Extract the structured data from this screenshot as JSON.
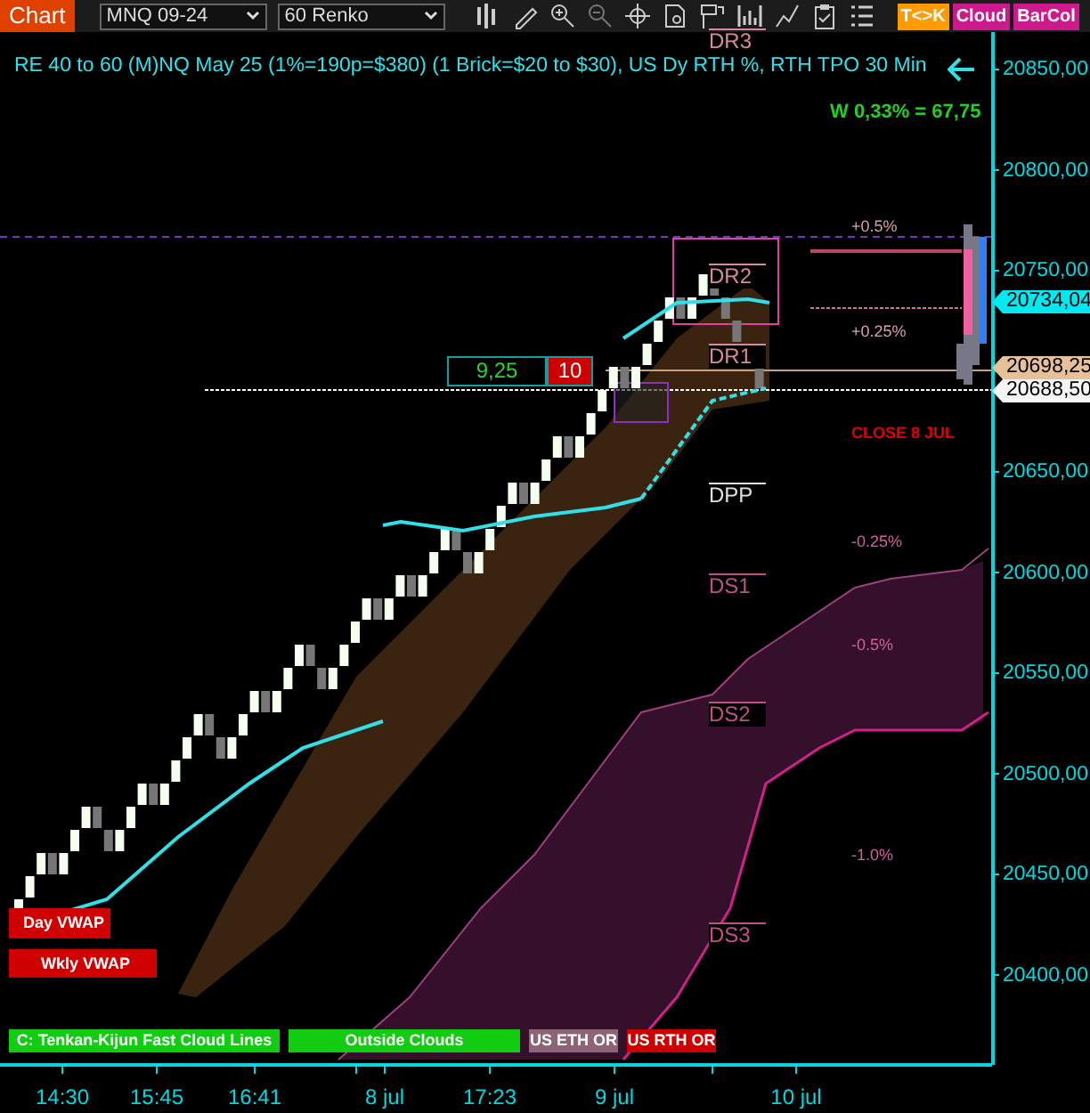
{
  "toolbar": {
    "title": "Chart",
    "instrument": "MNQ 09-24",
    "bar_type": "60 Renko",
    "buttons": [
      {
        "label": "T<>K",
        "color": "#ff9900"
      },
      {
        "label": "Cloud",
        "color": "#cc1a8c"
      },
      {
        "label": "BarCol",
        "color": "#cc1a8c"
      }
    ]
  },
  "chart": {
    "caption": "RE 40 to 60 (M)NQ May 25 (1%=190p=$380) (1 Brick=$20 to $30), US Dy RTH %, RTH TPO 30 Min",
    "range_text": "W 0,33% = 67,75",
    "levels": [
      {
        "label": "DR3",
        "color": "#d88a9c"
      },
      {
        "label": "DR2",
        "color": "#d88a9c"
      },
      {
        "label": "DR1",
        "color": "#d88a9c"
      },
      {
        "label": "DPP",
        "color": "#e0e0e0"
      },
      {
        "label": "DS1",
        "color": "#c0508a"
      },
      {
        "label": "DS2",
        "color": "#c0508a"
      },
      {
        "label": "DS3",
        "color": "#c0508a"
      }
    ],
    "percent_labels": [
      "+0.5%",
      "+0.25%",
      "-0.25%",
      "-0.5%",
      "-1.0%"
    ],
    "close_label": "CLOSE 8 JUL",
    "brick_counter": {
      "value": "9,25",
      "count": "10"
    },
    "vwap_labels": [
      "Day VWAP",
      "Wkly VWAP"
    ],
    "indicators": [
      {
        "label": "C: Tenkan-Kijun Fast Cloud Lines",
        "color": "#11cc11"
      },
      {
        "label": "Outside Clouds",
        "color": "#11cc11"
      },
      {
        "label": "US ETH OR",
        "color": "#8c6474"
      },
      {
        "label": "US RTH OR",
        "color": "#cc0000"
      }
    ],
    "price_markers": [
      {
        "label": "20734,04",
        "color": "#00e8f0"
      },
      {
        "label": "20698,25",
        "color": "#e6c098"
      },
      {
        "label": "20688,50",
        "color": "#f4f4f4"
      }
    ],
    "y_axis": [
      "20850,00",
      "20800,00",
      "20750,00",
      "20650,00",
      "20600,00",
      "20550,00",
      "20500,00",
      "20450,00",
      "20400,00"
    ],
    "x_axis": [
      "14:30",
      "15:45",
      "16:41",
      "8 jul",
      "17:23",
      "9 jul",
      "10 jul"
    ]
  }
}
